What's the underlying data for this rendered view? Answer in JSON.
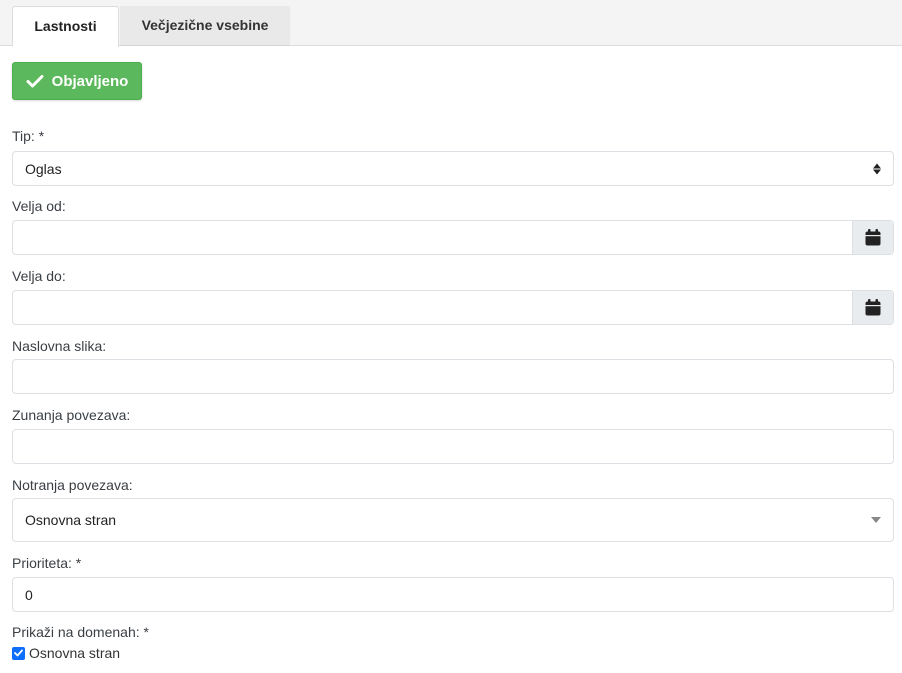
{
  "tabs": [
    {
      "label": "Lastnosti",
      "active": true
    },
    {
      "label": "Večjezične vsebine",
      "active": false
    }
  ],
  "publish_button": {
    "label": "Objavljeno",
    "icon": "check-icon",
    "color": "#5cb85c"
  },
  "form": {
    "type": {
      "label": "Tip: *",
      "value": "Oglas"
    },
    "valid_from": {
      "label": "Velja od:",
      "value": "",
      "icon": "calendar-icon"
    },
    "valid_to": {
      "label": "Velja do:",
      "value": "",
      "icon": "calendar-icon"
    },
    "cover_image": {
      "label": "Naslovna slika:",
      "value": ""
    },
    "external_link": {
      "label": "Zunanja povezava:",
      "value": ""
    },
    "internal_link": {
      "label": "Notranja povezava:",
      "value": "Osnovna stran"
    },
    "priority": {
      "label": "Prioriteta: *",
      "value": "0"
    },
    "domains": {
      "label": "Prikaži na domenah: *",
      "options": [
        {
          "label": "Osnovna stran",
          "checked": true
        }
      ]
    }
  }
}
